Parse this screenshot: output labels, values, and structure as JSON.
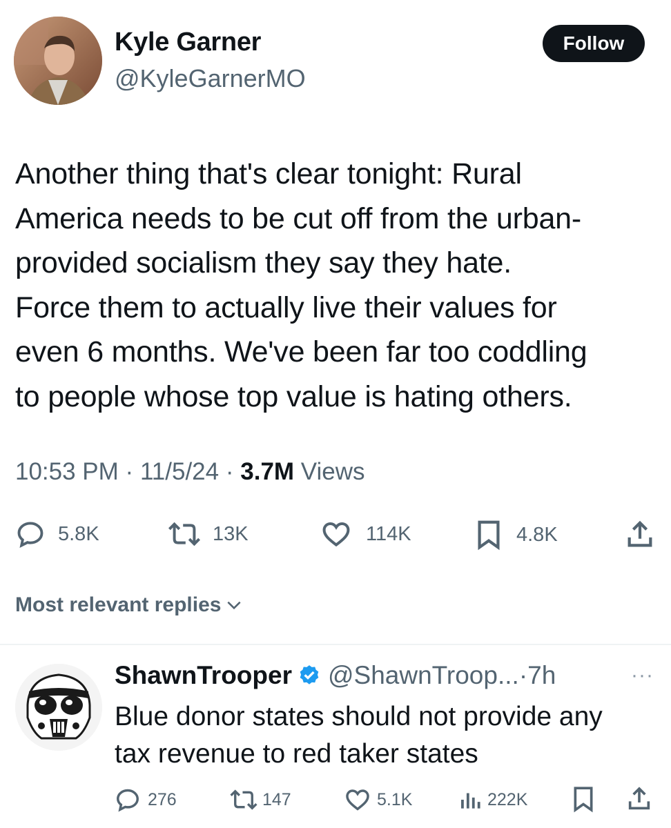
{
  "tweet": {
    "author_name": "Kyle Garner",
    "author_handle": "@KyleGarnerMO",
    "follow_label": "Follow",
    "text": "Another thing that's clear tonight: Rural\nAmerica needs to be cut off from the urban-\nprovided socialism they say they hate.\nForce them to actually live their values for\neven 6 months. We've been far too coddling\nto people whose top value is hating others.",
    "time": "10:53 PM",
    "date": "11/5/24",
    "views_count": "3.7M",
    "views_label": "Views",
    "replies": "5.8K",
    "reposts": "13K",
    "likes": "114K",
    "bookmarks": "4.8K"
  },
  "replies_section": {
    "sort_label": "Most relevant replies"
  },
  "reply": {
    "name": "ShawnTrooper",
    "verified": true,
    "handle": "@ShawnTroop...",
    "time": "7h",
    "more": "···",
    "text": "Blue donor states should not provide any\ntax revenue to red taker states",
    "replies": "276",
    "reposts": "147",
    "likes": "5.1K",
    "views": "222K"
  },
  "colors": {
    "text": "#0f1419",
    "secondary": "#536471",
    "verified": "#1d9bf0",
    "follow_bg": "#0f1419"
  }
}
